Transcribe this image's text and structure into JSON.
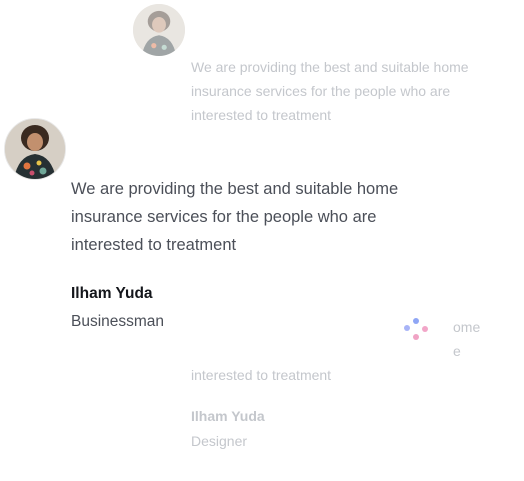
{
  "top_card": {
    "avatar": "woman-portrait-avatar",
    "quote_lines": [
      "We are providing the best and suitable home",
      "insurance services for the people who are",
      "interested to treatment"
    ]
  },
  "main_card": {
    "avatar": "woman-portrait-avatar",
    "quote_lines": [
      "We are providing the best and suitable home",
      "insurance services for the people who are",
      "interested to treatment"
    ],
    "name": "Ilham Yuda",
    "role": "Businessman"
  },
  "bottom_card": {
    "partial_lines": [
      "ome",
      "e"
    ],
    "quote_last_line": "interested to treatment",
    "name": "Ilham Yuda",
    "role": "Designer"
  },
  "loader": {
    "icon": "loading-dots-icon",
    "colors": [
      "#8fa6f5",
      "#f2a6c8",
      "#a8b4f7",
      "#f0a3c4"
    ]
  }
}
